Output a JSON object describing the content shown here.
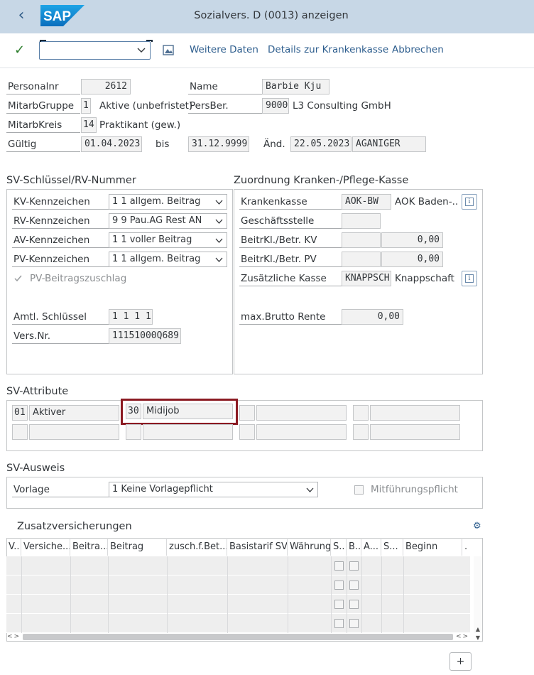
{
  "window": {
    "title": "Sozialvers. D (0013) anzeigen",
    "logo_text": "SAP"
  },
  "toolbar": {
    "command_value": "",
    "weitere_daten": "Weitere Daten",
    "details_krankenkasse": "Details zur Krankenkasse",
    "abbrechen": "Abbrechen"
  },
  "header": {
    "personalnr_label": "Personalnr",
    "personalnr": "2612",
    "name_label": "Name",
    "name": "Barbie Kju",
    "mitarbgruppe_label": "MitarbGruppe",
    "mitarbgruppe": "1",
    "mitarbgruppe_text": "Aktive (unbefristet)",
    "persber_label": "PersBer.",
    "persber": "9000",
    "persber_text": "L3 Consulting GmbH",
    "mitarbkreis_label": "MitarbKreis",
    "mitarbkreis": "14",
    "mitarbkreis_text": "Praktikant (gew.)",
    "gueltig_label": "Gültig",
    "gueltig_from": "01.04.2023",
    "bis_label": "bis",
    "gueltig_to": "31.12.9999",
    "aend_label": "Änd.",
    "aend_date": "22.05.2023",
    "aend_user": "AGANIGER"
  },
  "sv_schluessel": {
    "title": "SV-Schlüssel/RV-Nummer",
    "kv_label": "KV-Kennzeichen",
    "kv_value": "1 1 allgem. Beitrag",
    "rv_label": "RV-Kennzeichen",
    "rv_value": "9 9 Pau.AG Rest AN",
    "av_label": "AV-Kennzeichen",
    "av_value": "1 1 voller Beitrag",
    "pv_label": "PV-Kennzeichen",
    "pv_value": "1 1 allgem. Beitrag",
    "pv_zuschlag_label": "PV-Beitragszuschlag",
    "amtl_label": "Amtl. Schlüssel",
    "amtl_value": "1 1 1 1",
    "versnr_label": "Vers.Nr.",
    "versnr_value": "11151000Q689"
  },
  "zuordnung": {
    "title": "Zuordnung Kranken-/Pflege-Kasse",
    "krankenkasse_label": "Krankenkasse",
    "krankenkasse_code": "AOK-BW",
    "krankenkasse_text": "AOK Baden-...",
    "geschaeftsstelle_label": "Geschäftsstelle",
    "beitr_kv_label": "BeitrKl./Betr. KV",
    "beitr_kv_value": "0,00",
    "beitr_pv_label": "BeitrKl./Betr. PV",
    "beitr_pv_value": "0,00",
    "zusatz_kasse_label": "Zusätzliche Kasse",
    "zusatz_kasse_code": "KNAPPSCH",
    "zusatz_kasse_text": "Knappschaft",
    "max_brutto_label": "max.Brutto Rente",
    "max_brutto_value": "0,00"
  },
  "sv_attribute": {
    "title": "SV-Attribute",
    "attr1_code": "01",
    "attr1_text": "Aktiver",
    "attr2_code": "30",
    "attr2_text": "Midijob"
  },
  "sv_ausweis": {
    "title": "SV-Ausweis",
    "vorlage_label": "Vorlage",
    "vorlage_value": "1 Keine Vorlagepflicht",
    "mitfuehrung_label": "Mitführungspflicht"
  },
  "zusatzversicherungen": {
    "title": "Zusatzversicherungen",
    "columns": [
      "V..",
      "Versiche...",
      "Beitra...",
      "Beitrag",
      "zusch.f.Bet...",
      "Basistarif SV",
      "Währung",
      "S..",
      "B..",
      "A...",
      "S...",
      "Beginn",
      "."
    ],
    "row_count": 4,
    "add_label": "+"
  },
  "colors": {
    "titlebar": "#c7d7e6",
    "link": "#2e5e8e",
    "highlight_frame": "#8b1a22"
  }
}
